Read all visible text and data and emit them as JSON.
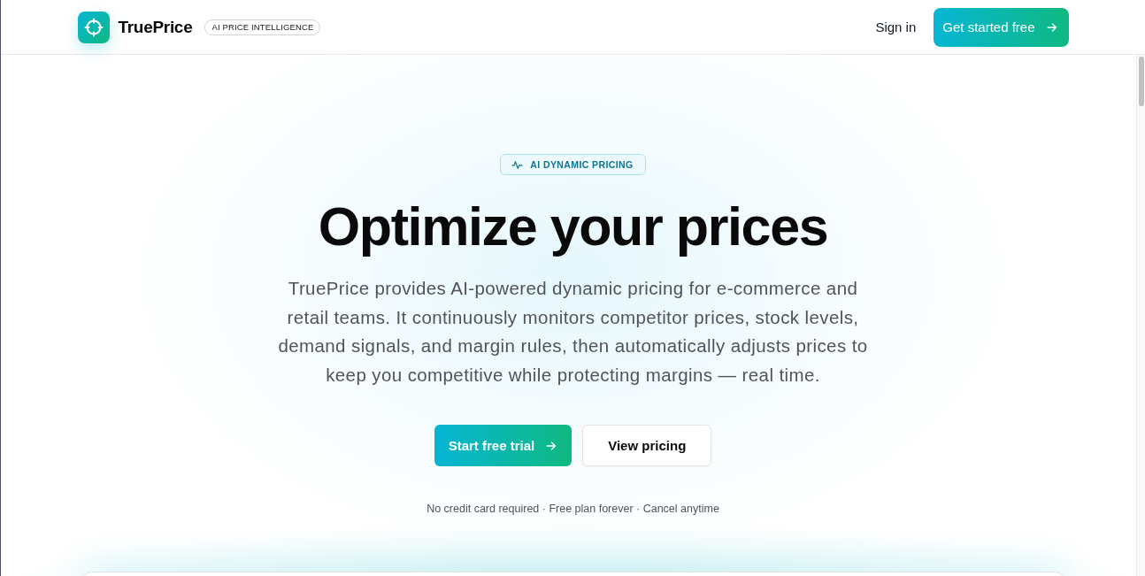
{
  "header": {
    "brand": "TruePrice",
    "tagline": "AI PRICE INTELLIGENCE",
    "sign_in": "Sign in",
    "cta": "Get started free"
  },
  "hero": {
    "badge": "AI DYNAMIC PRICING",
    "title": "Optimize your prices",
    "description": "TruePrice provides AI-powered dynamic pricing for e-commerce and retail teams. It continuously monitors competitor prices, stock levels, demand signals, and margin rules, then automatically adjusts prices to keep you competitive while protecting margins — real time.",
    "buttons": [
      {
        "label": "Start free trial",
        "kind": "primary"
      },
      {
        "label": "View pricing",
        "kind": "secondary"
      }
    ],
    "note": "No credit card required · Free plan forever · Cancel anytime"
  }
}
